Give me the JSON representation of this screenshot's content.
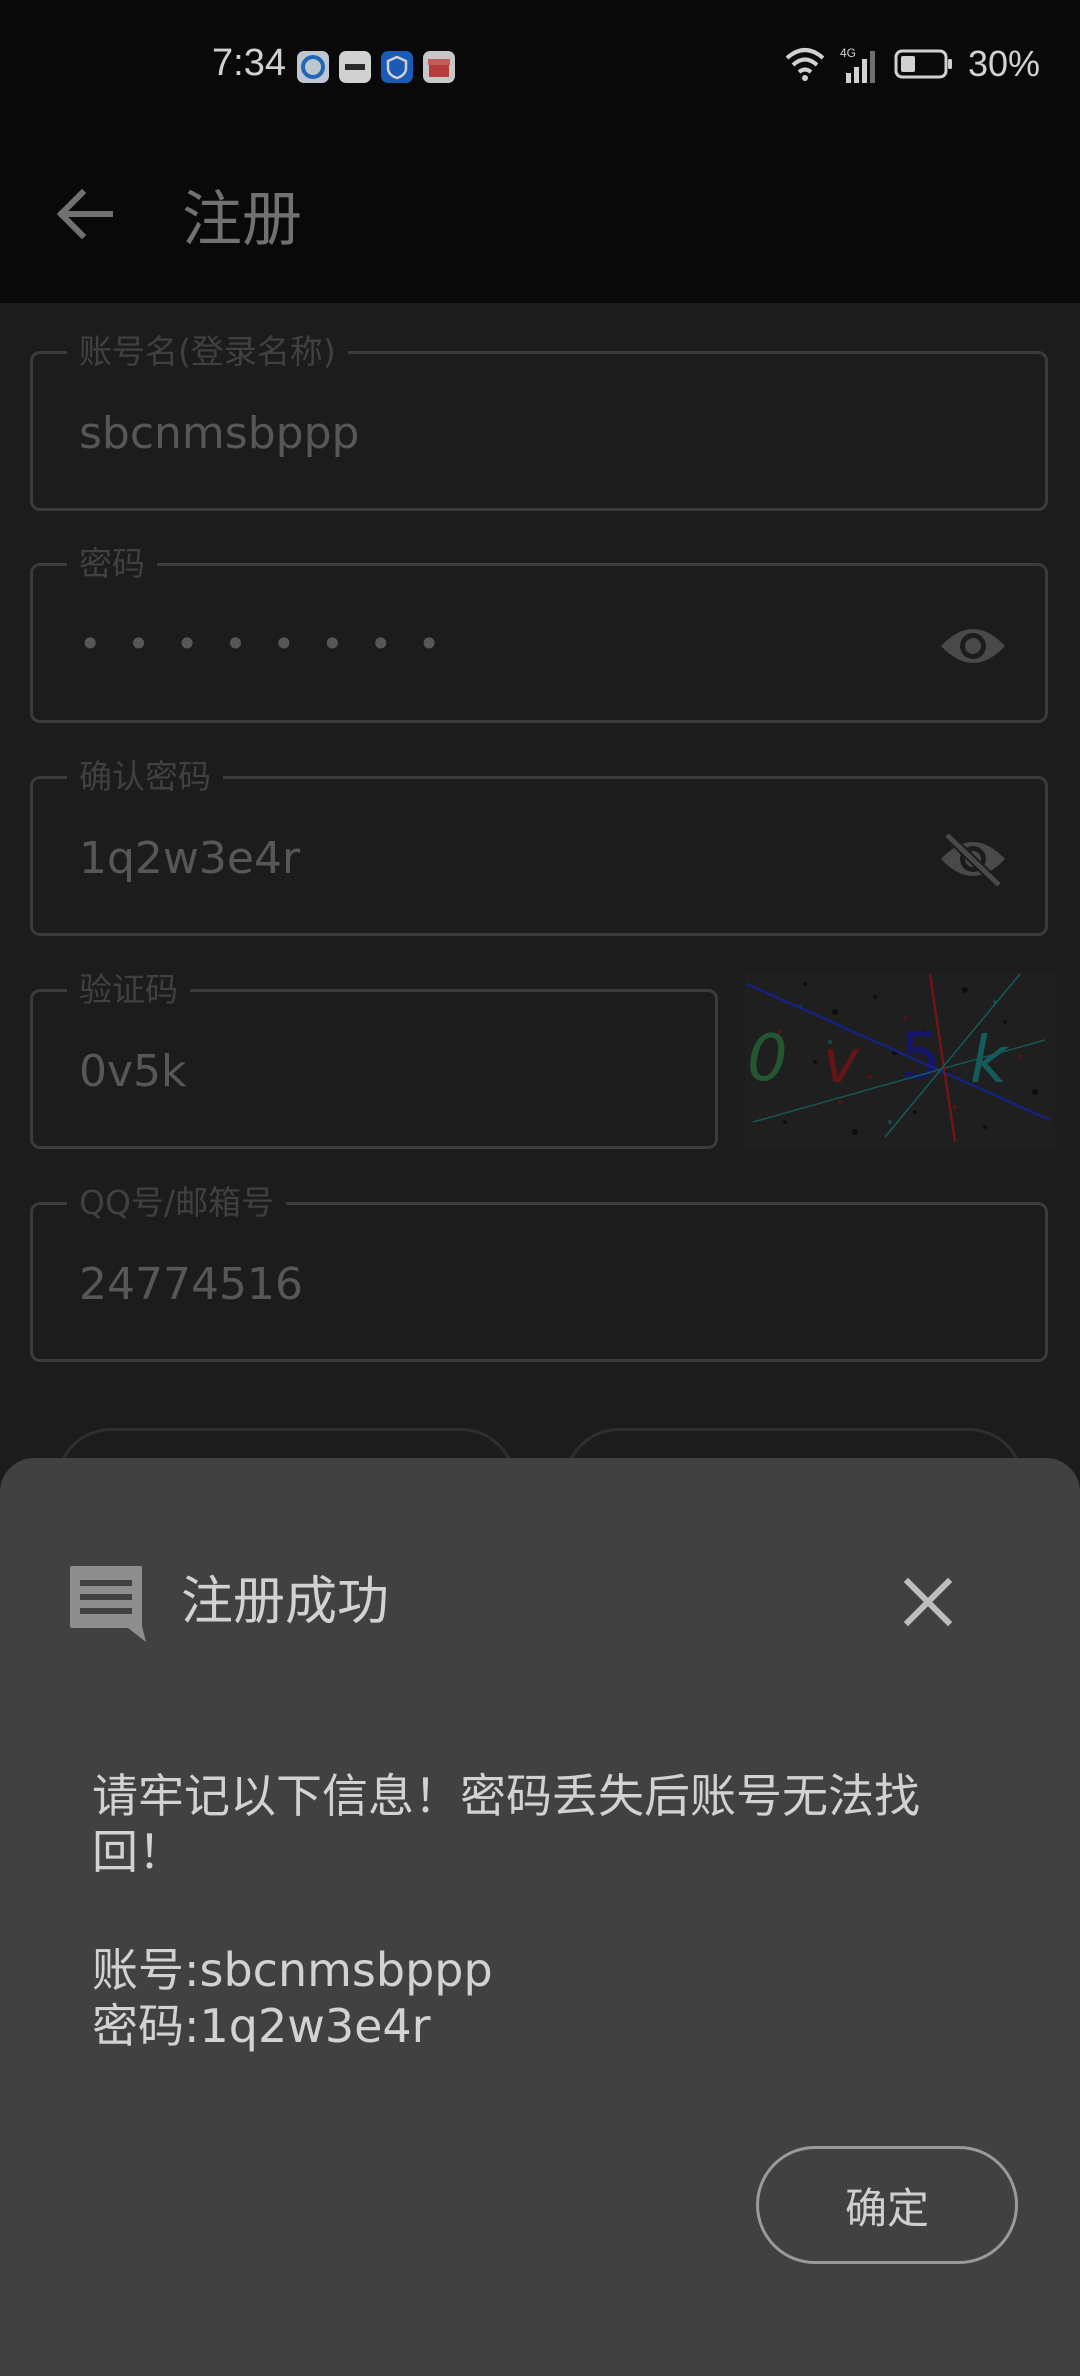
{
  "status_bar": {
    "time": "7:34",
    "notification_icons": [
      "browser-icon",
      "huawei-icon",
      "security-icon",
      "gift-icon"
    ],
    "status_icons": [
      "wifi-icon",
      "signal-4g-icon",
      "battery-icon"
    ],
    "battery_percent": "30%"
  },
  "toolbar": {
    "title": "注册"
  },
  "form": {
    "account": {
      "label": "账号名(登录名称)",
      "value": "sbcnmsbppp"
    },
    "password": {
      "label": "密码",
      "value": "••••••••"
    },
    "confirm_password": {
      "label": "确认密码",
      "value": "1q2w3e4r"
    },
    "captcha": {
      "label": "验证码",
      "value": "0v5k"
    },
    "contact": {
      "label": "QQ号/邮箱号",
      "value": "24774516"
    }
  },
  "dialog": {
    "title": "注册成功",
    "message_line1": "请牢记以下信息！密码丢失后账号无法找回！",
    "account_line": "账号:sbcnmsbppp",
    "password_line": "密码:1q2w3e4r",
    "confirm_label": "确定"
  },
  "colors": {
    "sheet_bg": "#414141",
    "toolbar_bg": "#0c0c0c",
    "form_bg": "#232323"
  }
}
